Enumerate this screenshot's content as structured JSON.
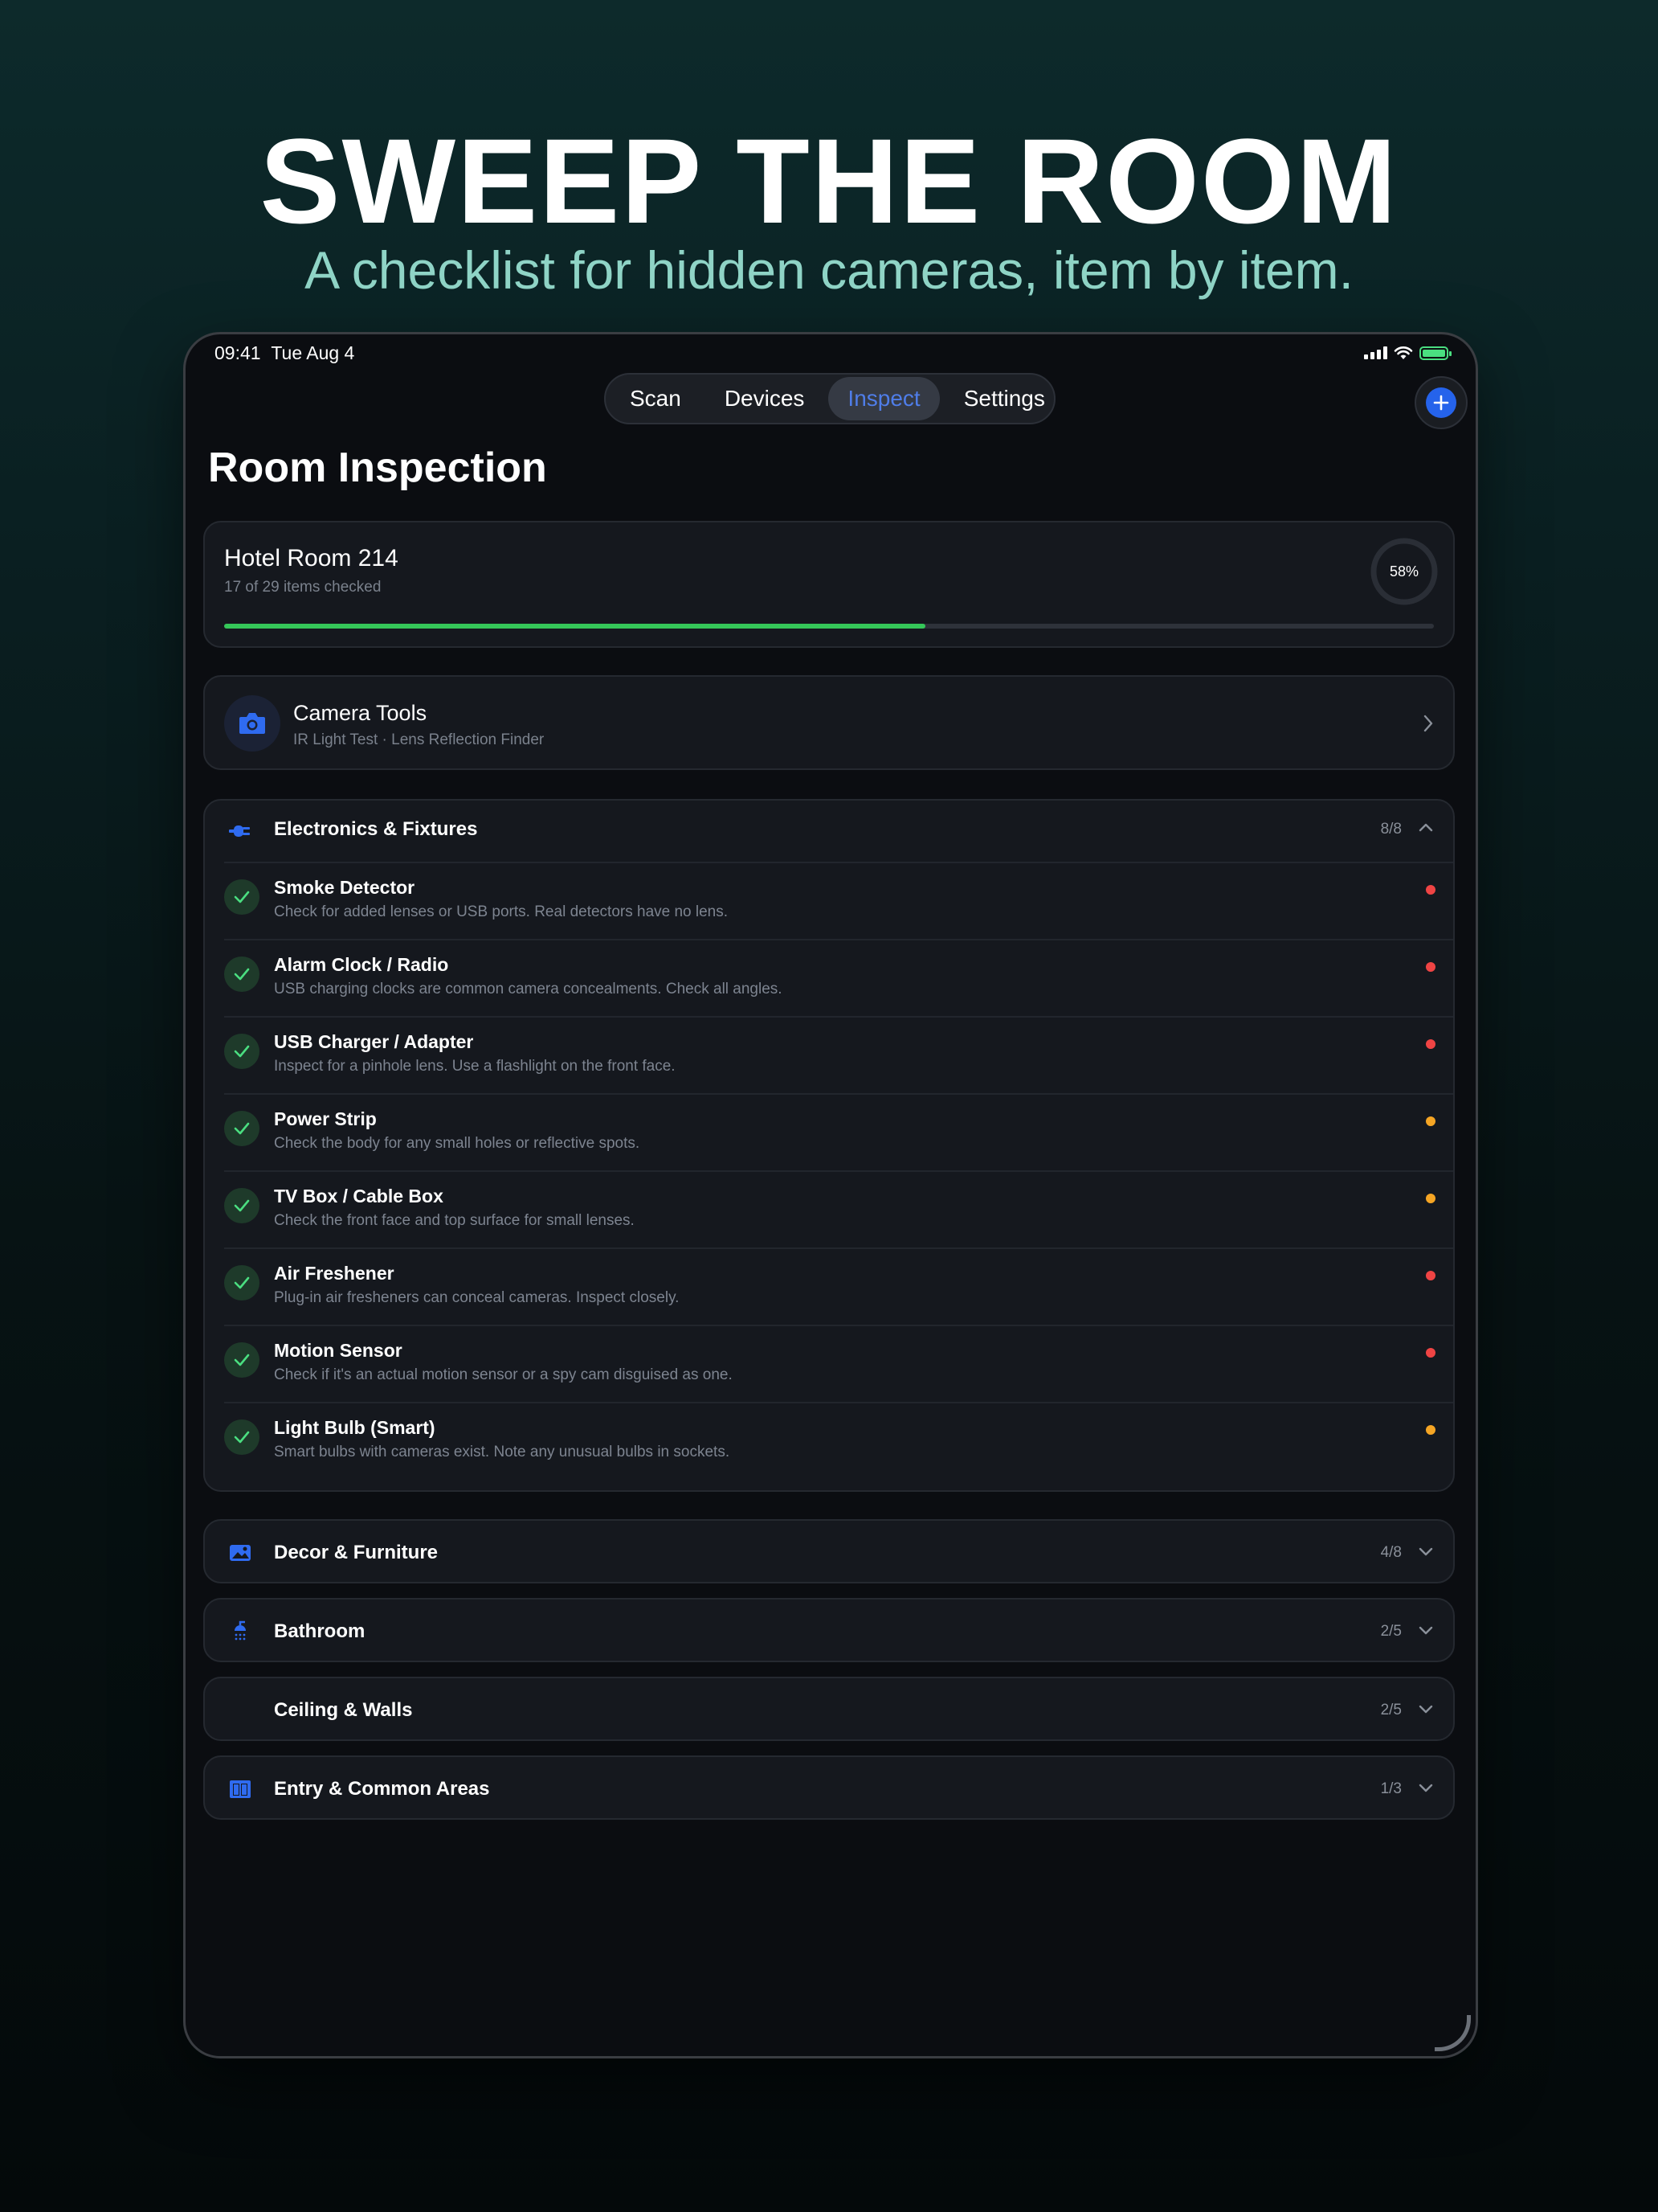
{
  "hero": {
    "title": "SWEEP THE ROOM",
    "subtitle": "A checklist for hidden cameras, item by item."
  },
  "status_bar": {
    "time": "09:41",
    "date": "Tue Aug 4"
  },
  "tabs": [
    {
      "label": "Scan",
      "active": false
    },
    {
      "label": "Devices",
      "active": false
    },
    {
      "label": "Inspect",
      "active": true
    },
    {
      "label": "Settings",
      "active": false
    }
  ],
  "page": {
    "title": "Room Inspection"
  },
  "progress": {
    "room": "Hotel Room 214",
    "summary": "17 of 29 items checked",
    "percent_label": "58%",
    "fraction": 0.58
  },
  "camera_tools": {
    "title": "Camera Tools",
    "subtitle": "IR Light Test · Lens Reflection Finder",
    "icon": "camera-icon"
  },
  "sections": [
    {
      "label": "Electronics & Fixtures",
      "count": "8/8",
      "icon": "plug-icon",
      "expanded": true,
      "items": [
        {
          "title": "Smoke Detector",
          "desc": "Check for added lenses or USB ports. Real detectors have no lens.",
          "priority_color": "#ef4444"
        },
        {
          "title": "Alarm Clock / Radio",
          "desc": "USB charging clocks are common camera concealments. Check all angles.",
          "priority_color": "#ef4444"
        },
        {
          "title": "USB Charger / Adapter",
          "desc": "Inspect for a pinhole lens. Use a flashlight on the front face.",
          "priority_color": "#ef4444"
        },
        {
          "title": "Power Strip",
          "desc": "Check the body for any small holes or reflective spots.",
          "priority_color": "#f5a524"
        },
        {
          "title": "TV Box / Cable Box",
          "desc": "Check the front face and top surface for small lenses.",
          "priority_color": "#f5a524"
        },
        {
          "title": "Air Freshener",
          "desc": "Plug-in air fresheners can conceal cameras. Inspect closely.",
          "priority_color": "#ef4444"
        },
        {
          "title": "Motion Sensor",
          "desc": "Check if it's an actual motion sensor or a spy cam disguised as one.",
          "priority_color": "#ef4444"
        },
        {
          "title": "Light Bulb (Smart)",
          "desc": "Smart bulbs with cameras exist. Note any unusual bulbs in sockets.",
          "priority_color": "#f5a524"
        }
      ]
    },
    {
      "label": "Decor & Furniture",
      "count": "4/8",
      "icon": "image-icon",
      "expanded": false
    },
    {
      "label": "Bathroom",
      "count": "2/5",
      "icon": "shower-icon",
      "expanded": false
    },
    {
      "label": "Ceiling & Walls",
      "count": "2/5",
      "icon": "",
      "expanded": false
    },
    {
      "label": "Entry & Common Areas",
      "count": "1/3",
      "icon": "door-icon",
      "expanded": false
    }
  ],
  "colors": {
    "accent": "#2563eb",
    "active_tab_text": "#4f7de8",
    "progress_green": "#35c759",
    "check_green": "#4ade80"
  }
}
